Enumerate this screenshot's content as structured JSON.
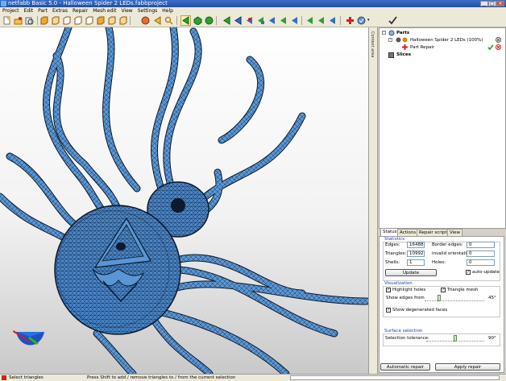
{
  "window": {
    "title": "netfabb Basic 5.0 - Halloween Spider 2 LEDs.fabbproject"
  },
  "menu": [
    "Project",
    "Edit",
    "Part",
    "Extras",
    "Repair",
    "Mesh edit",
    "View",
    "Settings",
    "Help"
  ],
  "side_strip": {
    "label": "Context area"
  },
  "tree": {
    "parts_label": "Parts",
    "part_name": "Halloween Spider 2 LEDs (100%)",
    "repair_label": "Part Repair",
    "slices_label": "Slices"
  },
  "tabs": [
    "Status",
    "Actions",
    "Repair scripts",
    "View"
  ],
  "statistics": {
    "group_label": "Statistics",
    "edges_label": "Edges:",
    "edges_value": "16488",
    "triangles_label": "Triangles:",
    "triangles_value": "10992",
    "shells_label": "Shells:",
    "shells_value": "1",
    "border_edges_label": "Border edges:",
    "border_edges_value": "0",
    "invalid_orientation_label": "invalid orientation:",
    "invalid_orientation_value": "0",
    "holes_label": "Holes:",
    "holes_value": "0",
    "update_label": "Update",
    "auto_update_label": "auto-update"
  },
  "visualization": {
    "group_label": "Visualization",
    "highlight_holes_label": "Highlight holes",
    "triangle_mesh_label": "Triangle mesh",
    "show_edges_label": "Show edges from",
    "show_edges_value": "45°",
    "show_degenerated_label": "Show degenerated faces"
  },
  "surface_selection": {
    "group_label": "Surface selection",
    "tolerance_label": "Selection tolerance:",
    "tolerance_value": "90°"
  },
  "actions": {
    "automatic_repair_label": "Automatic repair",
    "apply_repair_label": "Apply repair"
  },
  "status": {
    "left": "Select triangles",
    "hint": "Press Shift to add / remove triangles to / from the current selection"
  },
  "colors": {
    "mesh": "#4a86c8",
    "mesh_dark": "#0b1a2e",
    "accent_red": "#d42020",
    "check_green": "#2a9a2a",
    "title_blue": "#2456b0"
  }
}
